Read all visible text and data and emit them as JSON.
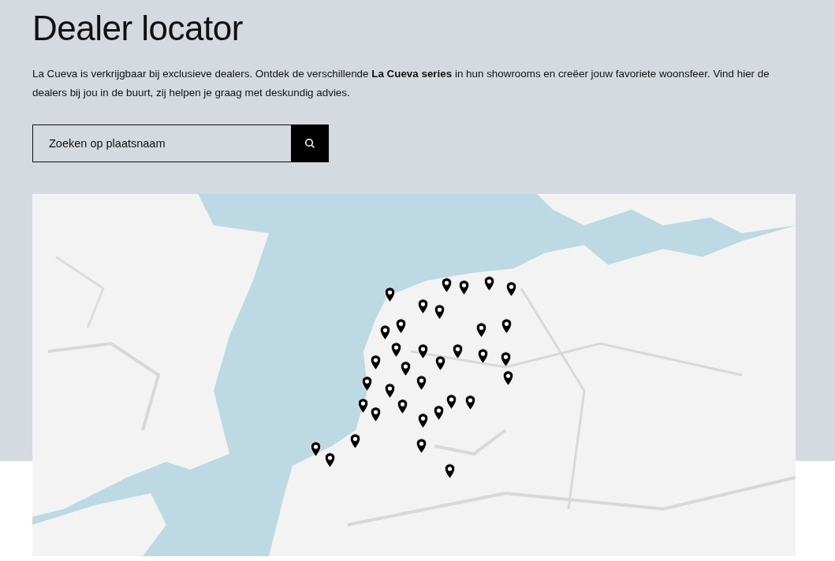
{
  "title": "Dealer locator",
  "intro": "La Cueva is verkrijgbaar bij exclusieve dealers. Ontdek de verschillende **La Cueva series** in hun showrooms en creëer jouw favoriete woonsfeer. Vind hier de dealers bij jou in de buurt, zij helpen je graag met deskundig advies.",
  "search": {
    "placeholder": "Zoeken op plaatsnaam"
  }
}
